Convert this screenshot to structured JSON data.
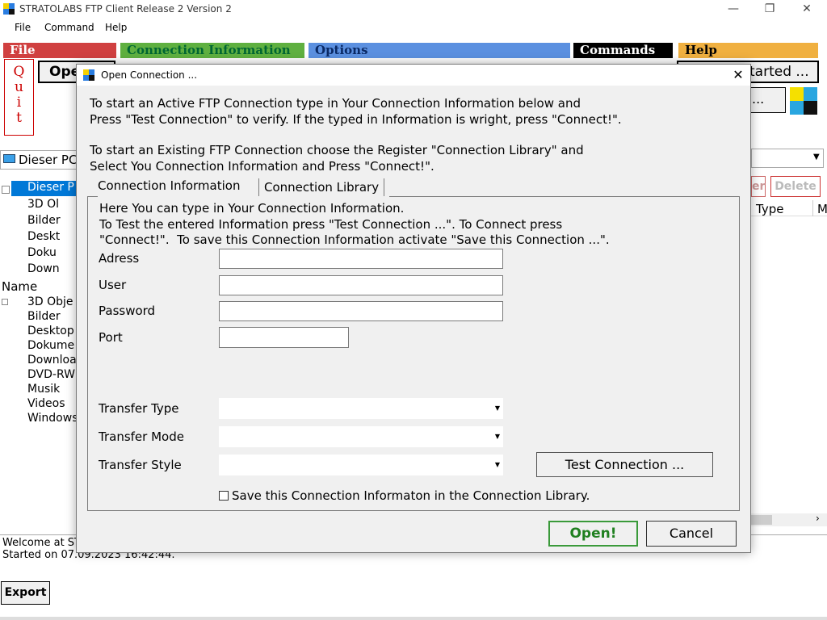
{
  "window": {
    "title": "STRATOLABS FTP Client Release 2 Version 2",
    "controls": {
      "minimize": "—",
      "maximize": "❐",
      "close": "✕"
    }
  },
  "menu": [
    "File",
    "Command",
    "Help"
  ],
  "sections": [
    {
      "label": "File",
      "color": "#d04040"
    },
    {
      "label": "Connection Information",
      "color": "#5fb040"
    },
    {
      "label": "Options",
      "color": "#5b90e0"
    },
    {
      "label": "Commands",
      "color": "#000000"
    },
    {
      "label": "Help",
      "color": "#f0b040"
    }
  ],
  "background": {
    "quit_letters": [
      "Q",
      "u",
      "i",
      "t"
    ],
    "open_button_partial": "Ope",
    "started_partial": "tarted ...",
    "dots_partial": "...",
    "path_combo": "Dieser PC",
    "rename_partial": "er",
    "delete_label": "Delete",
    "type_header": "Type",
    "m_header": "M",
    "tree": [
      "Dieser P",
      "3D Ol",
      "Bilder",
      "Deskt",
      "Doku",
      "Down"
    ],
    "list_header": "Name",
    "list_items": [
      "3D Obje",
      "Bilder",
      "Desktop",
      "Dokume",
      "Downloa",
      "DVD-RW",
      "Musik",
      "Videos",
      "Windows"
    ],
    "log_lines": [
      "Welcome at ST",
      "Started on 07.09.2023 16:42:44."
    ],
    "export_label": "Export"
  },
  "dialog": {
    "title": "Open Connection ...",
    "intro1_line1": "To start an Active FTP Connection type in Your Connection Information below and",
    "intro1_line2": "Press \"Test Connection\" to verify. If the typed in Information is wright, press \"Connect!\".",
    "intro2_line1": "To start an Existing FTP Connection choose the Register \"Connection Library\" and",
    "intro2_line2": "Select You Connection Information and Press \"Connect!\".",
    "tabs": [
      "Connection Information",
      "Connection Library"
    ],
    "panel_intro_line1": "Here You can type in Your Connection Information.",
    "panel_intro_line2": "To Test the entered Information press \"Test Connection ...\". To Connect press",
    "panel_intro_line3": "\"Connect!\".  To save this Connection Information activate \"Save this Connection ...\".",
    "fields": {
      "address": {
        "label": "Adress",
        "value": ""
      },
      "user": {
        "label": "User",
        "value": ""
      },
      "password": {
        "label": "Password",
        "value": ""
      },
      "port": {
        "label": "Port",
        "value": ""
      }
    },
    "transfer_type": {
      "label": "Transfer Type",
      "value": ""
    },
    "transfer_mode": {
      "label": "Transfer Mode",
      "value": ""
    },
    "transfer_style": {
      "label": "Transfer Style",
      "value": ""
    },
    "test_connection_label": "Test Connection ...",
    "save_checkbox_label": "Save this Connection Informaton in the Connection Library.",
    "open_label": "Open!",
    "cancel_label": "Cancel"
  }
}
